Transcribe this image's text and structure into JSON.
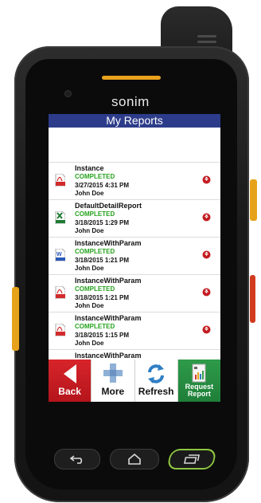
{
  "device": {
    "brand": "sonim"
  },
  "app": {
    "title": "My Reports"
  },
  "reports": [
    {
      "name": "Instance",
      "status": "COMPLETED",
      "date": "3/27/2015 4:31 PM",
      "user": "John Doe",
      "file_type": "PDF"
    },
    {
      "name": "DefaultDetailReport",
      "status": "COMPLETED",
      "date": "3/18/2015 1:29 PM",
      "user": "John Doe",
      "file_type": "XLS"
    },
    {
      "name": "InstanceWithParam",
      "status": "COMPLETED",
      "date": "3/18/2015 1:21 PM",
      "user": "John Doe",
      "file_type": "DOC"
    },
    {
      "name": "InstanceWithParam",
      "status": "COMPLETED",
      "date": "3/18/2015 1:21 PM",
      "user": "John Doe",
      "file_type": "PDF"
    },
    {
      "name": "InstanceWithParam",
      "status": "COMPLETED",
      "date": "3/18/2015 1:15 PM",
      "user": "John Doe",
      "file_type": "PDF"
    },
    {
      "name": "InstanceWithParam",
      "status": "",
      "date": "",
      "user": "",
      "file_type": ""
    }
  ],
  "toolbar": {
    "back_label": "Back",
    "more_label": "More",
    "refresh_label": "Refresh",
    "request_label_1": "Request",
    "request_label_2": "Report"
  },
  "colors": {
    "title_bar": "#2d3c8a",
    "status_completed": "#25a31d",
    "back_button": "#c91d24",
    "request_button": "#268c42",
    "accent_yellow": "#e6a21a"
  },
  "icons": {
    "pdf": "pdf-file-icon",
    "xls": "xls-file-icon",
    "doc": "doc-file-icon",
    "download": "download-arrow-icon",
    "back": "back-arrow-icon",
    "more": "plus-icon",
    "refresh": "refresh-icon",
    "request": "request-report-icon"
  }
}
